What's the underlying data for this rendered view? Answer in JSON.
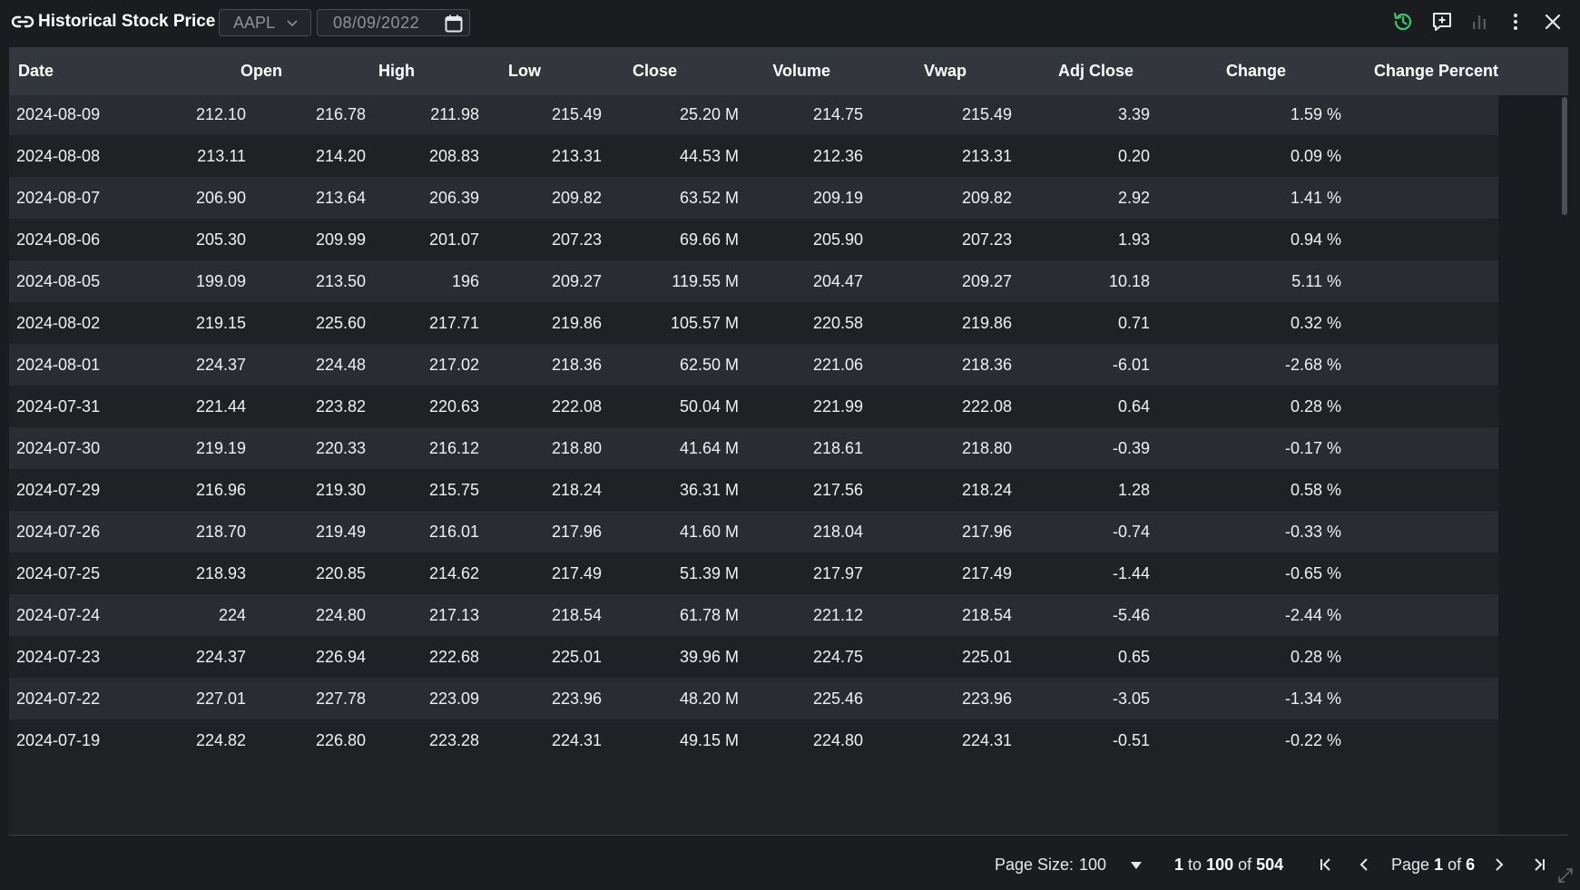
{
  "window": {
    "title": "Historical Stock Price",
    "ticker": "AAPL",
    "date": "08/09/2022"
  },
  "icons": {
    "link": "link-icon",
    "history": "history-icon",
    "comment": "comment-add-icon",
    "chart": "bar-chart-icon",
    "menu": "more-vertical-icon",
    "close": "close-icon",
    "history_color": "#3ec46d"
  },
  "table": {
    "columns": [
      "Date",
      "Open",
      "High",
      "Low",
      "Close",
      "Volume",
      "Vwap",
      "Adj Close",
      "Change",
      "Change Percent"
    ],
    "rows": [
      [
        "2024-08-09",
        "212.10",
        "216.78",
        "211.98",
        "215.49",
        "25.20 M",
        "214.75",
        "215.49",
        "3.39",
        "1.59 %"
      ],
      [
        "2024-08-08",
        "213.11",
        "214.20",
        "208.83",
        "213.31",
        "44.53 M",
        "212.36",
        "213.31",
        "0.20",
        "0.09 %"
      ],
      [
        "2024-08-07",
        "206.90",
        "213.64",
        "206.39",
        "209.82",
        "63.52 M",
        "209.19",
        "209.82",
        "2.92",
        "1.41 %"
      ],
      [
        "2024-08-06",
        "205.30",
        "209.99",
        "201.07",
        "207.23",
        "69.66 M",
        "205.90",
        "207.23",
        "1.93",
        "0.94 %"
      ],
      [
        "2024-08-05",
        "199.09",
        "213.50",
        "196",
        "209.27",
        "119.55 M",
        "204.47",
        "209.27",
        "10.18",
        "5.11 %"
      ],
      [
        "2024-08-02",
        "219.15",
        "225.60",
        "217.71",
        "219.86",
        "105.57 M",
        "220.58",
        "219.86",
        "0.71",
        "0.32 %"
      ],
      [
        "2024-08-01",
        "224.37",
        "224.48",
        "217.02",
        "218.36",
        "62.50 M",
        "221.06",
        "218.36",
        "-6.01",
        "-2.68 %"
      ],
      [
        "2024-07-31",
        "221.44",
        "223.82",
        "220.63",
        "222.08",
        "50.04 M",
        "221.99",
        "222.08",
        "0.64",
        "0.28 %"
      ],
      [
        "2024-07-30",
        "219.19",
        "220.33",
        "216.12",
        "218.80",
        "41.64 M",
        "218.61",
        "218.80",
        "-0.39",
        "-0.17 %"
      ],
      [
        "2024-07-29",
        "216.96",
        "219.30",
        "215.75",
        "218.24",
        "36.31 M",
        "217.56",
        "218.24",
        "1.28",
        "0.58 %"
      ],
      [
        "2024-07-26",
        "218.70",
        "219.49",
        "216.01",
        "217.96",
        "41.60 M",
        "218.04",
        "217.96",
        "-0.74",
        "-0.33 %"
      ],
      [
        "2024-07-25",
        "218.93",
        "220.85",
        "214.62",
        "217.49",
        "51.39 M",
        "217.97",
        "217.49",
        "-1.44",
        "-0.65 %"
      ],
      [
        "2024-07-24",
        "224",
        "224.80",
        "217.13",
        "218.54",
        "61.78 M",
        "221.12",
        "218.54",
        "-5.46",
        "-2.44 %"
      ],
      [
        "2024-07-23",
        "224.37",
        "226.94",
        "222.68",
        "225.01",
        "39.96 M",
        "224.75",
        "225.01",
        "0.65",
        "0.28 %"
      ],
      [
        "2024-07-22",
        "227.01",
        "227.78",
        "223.09",
        "223.96",
        "48.20 M",
        "225.46",
        "223.96",
        "-3.05",
        "-1.34 %"
      ],
      [
        "2024-07-19",
        "224.82",
        "226.80",
        "223.28",
        "224.31",
        "49.15 M",
        "224.80",
        "224.31",
        "-0.51",
        "-0.22 %"
      ]
    ]
  },
  "pagination": {
    "page_size_label": "Page Size:",
    "page_size": "100",
    "range_from": "1",
    "range_to_word": "to",
    "range_to": "100",
    "of_word": "of",
    "total": "504",
    "page_word": "Page",
    "page": "1",
    "pages": "6",
    "first_icon": "first-page-icon",
    "prev_icon": "previous-page-icon",
    "next_icon": "next-page-icon",
    "last_icon": "last-page-icon"
  }
}
